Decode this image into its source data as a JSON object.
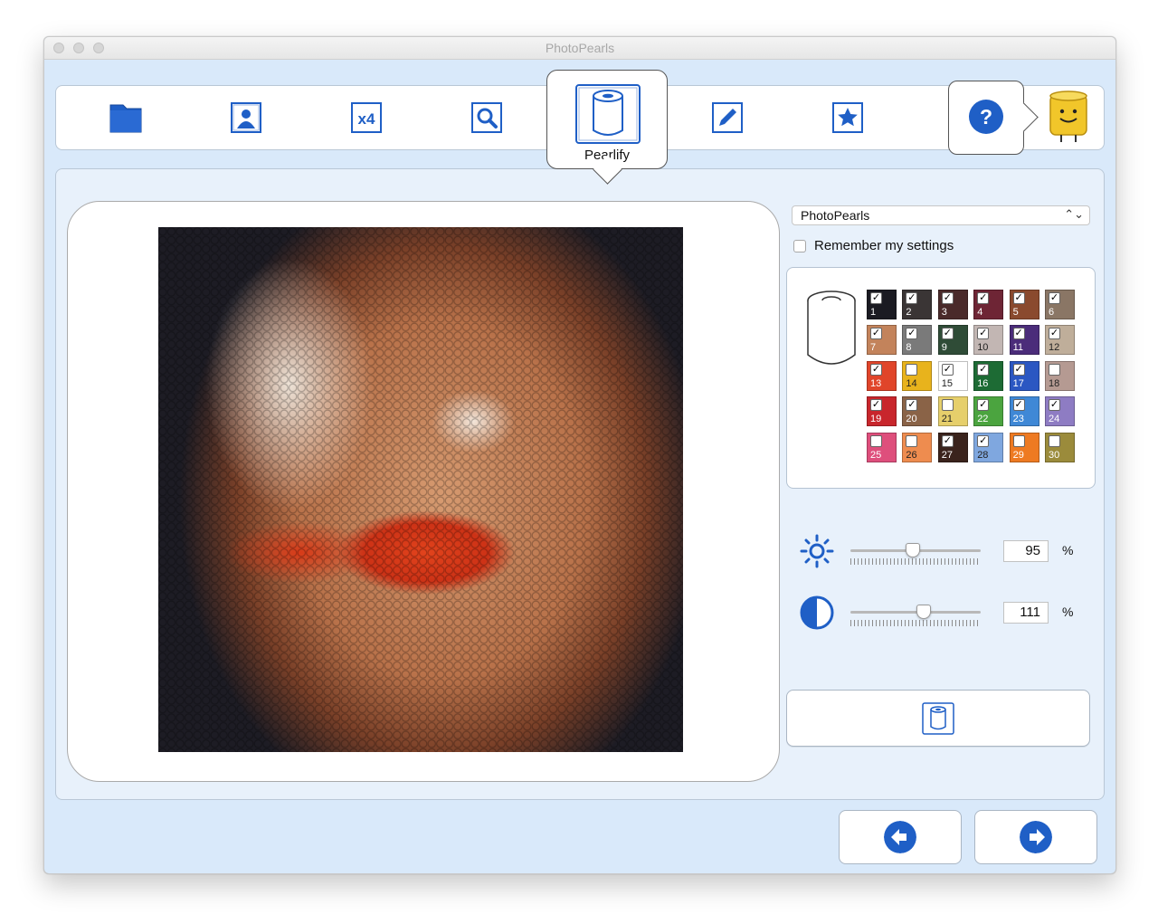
{
  "window": {
    "title": "PhotoPearls"
  },
  "toolbar": {
    "items": [
      {
        "icon": "folder-icon",
        "label": ""
      },
      {
        "icon": "portrait-icon",
        "label": ""
      },
      {
        "icon": "x4-icon",
        "label": "x4"
      },
      {
        "icon": "magnifier-icon",
        "label": ""
      },
      {
        "icon": "pearl-roll-icon",
        "label": "Pearlify",
        "active": true
      },
      {
        "icon": "pencil-icon",
        "label": ""
      },
      {
        "icon": "star-icon",
        "label": ""
      },
      {
        "icon": "help-icon",
        "label": "?"
      }
    ]
  },
  "settings": {
    "palette_select": "PhotoPearls",
    "remember_label": "Remember my settings",
    "remember_checked": false
  },
  "colors": [
    {
      "n": "1",
      "c": "#1b1b22",
      "on": true
    },
    {
      "n": "2",
      "c": "#3a3535",
      "on": true
    },
    {
      "n": "3",
      "c": "#4a2a2a",
      "on": true
    },
    {
      "n": "4",
      "c": "#6e2535",
      "on": true
    },
    {
      "n": "5",
      "c": "#8a4a2e",
      "on": true
    },
    {
      "n": "6",
      "c": "#8a7665",
      "on": true
    },
    {
      "n": "7",
      "c": "#c3835b",
      "on": true
    },
    {
      "n": "8",
      "c": "#7a7a7a",
      "on": true
    },
    {
      "n": "9",
      "c": "#2f4c37",
      "on": true
    },
    {
      "n": "10",
      "c": "#c2b6b3",
      "on": true
    },
    {
      "n": "11",
      "c": "#4b2c7a",
      "on": true
    },
    {
      "n": "12",
      "c": "#bfae9a",
      "on": true
    },
    {
      "n": "13",
      "c": "#e0452a",
      "on": true
    },
    {
      "n": "14",
      "c": "#e8b31c",
      "on": false
    },
    {
      "n": "15",
      "c": "#ffffff",
      "on": true
    },
    {
      "n": "16",
      "c": "#1d6b34",
      "on": true
    },
    {
      "n": "17",
      "c": "#2b57c2",
      "on": true
    },
    {
      "n": "18",
      "c": "#b59a92",
      "on": false
    },
    {
      "n": "19",
      "c": "#c8262c",
      "on": true
    },
    {
      "n": "20",
      "c": "#8a6347",
      "on": true
    },
    {
      "n": "21",
      "c": "#e6cf6b",
      "on": false
    },
    {
      "n": "22",
      "c": "#4ba43f",
      "on": true
    },
    {
      "n": "23",
      "c": "#3f88d6",
      "on": true
    },
    {
      "n": "24",
      "c": "#8e7cc3",
      "on": true
    },
    {
      "n": "25",
      "c": "#de4f7c",
      "on": false
    },
    {
      "n": "26",
      "c": "#ee8c4f",
      "on": false
    },
    {
      "n": "27",
      "c": "#3a231c",
      "on": true
    },
    {
      "n": "28",
      "c": "#7fa7df",
      "on": true
    },
    {
      "n": "29",
      "c": "#ee7a22",
      "on": false
    },
    {
      "n": "30",
      "c": "#9b8b3b",
      "on": false
    }
  ],
  "adjustments": {
    "brightness": {
      "icon": "sun-icon",
      "value": "95",
      "unit": "%",
      "fraction": 0.48
    },
    "contrast": {
      "icon": "contrast-icon",
      "value": "111",
      "unit": "%",
      "fraction": 0.56
    }
  },
  "accent_color": "#1f5fc6"
}
